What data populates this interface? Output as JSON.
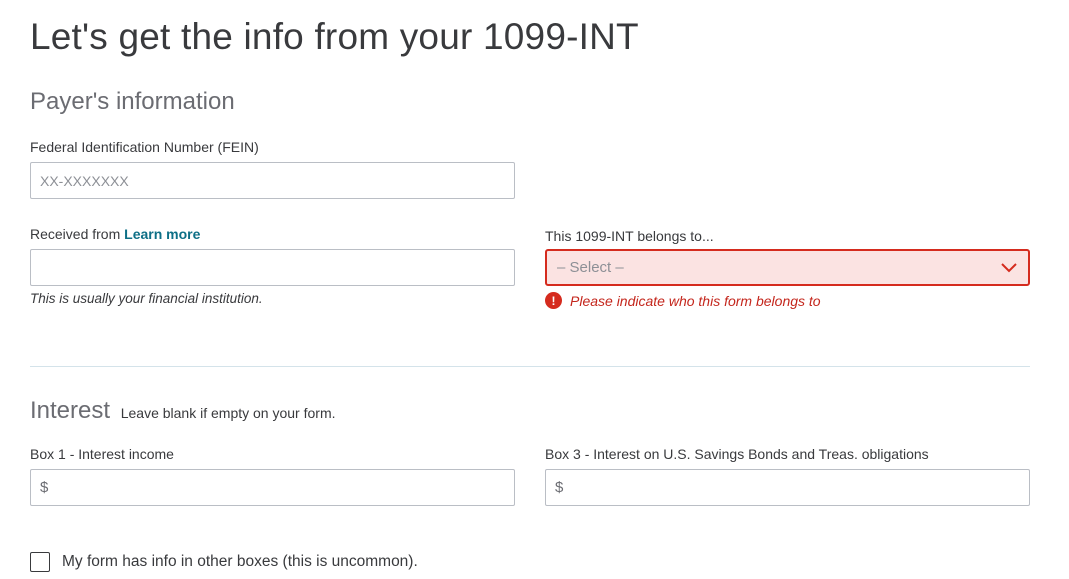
{
  "title": "Let's get the info from your 1099-INT",
  "payer": {
    "section_title": "Payer's information",
    "fein_label": "Federal Identification Number (FEIN)",
    "fein_placeholder": "XX-XXXXXXX",
    "fein_value": "",
    "received_label": "Received from",
    "learn_more": "Learn more",
    "received_value": "",
    "received_hint": "This is usually your financial institution.",
    "belongs_label": "This 1099-INT belongs to...",
    "belongs_selected": "– Select –",
    "belongs_error": "Please indicate who this form belongs to",
    "error_icon_glyph": "!"
  },
  "interest": {
    "title": "Interest",
    "subtitle": "Leave blank if empty on your form.",
    "box1_label": "Box 1 - Interest income",
    "box1_prefix": "$",
    "box1_value": "",
    "box3_label": "Box 3 - Interest on U.S. Savings Bonds and Treas. obligations",
    "box3_prefix": "$",
    "box3_value": ""
  },
  "other_boxes": {
    "label": "My form has info in other boxes (this is uncommon).",
    "checked": false
  },
  "colors": {
    "error": "#d52b1e",
    "error_bg": "#fbe3e2",
    "link": "#0d6f86"
  }
}
